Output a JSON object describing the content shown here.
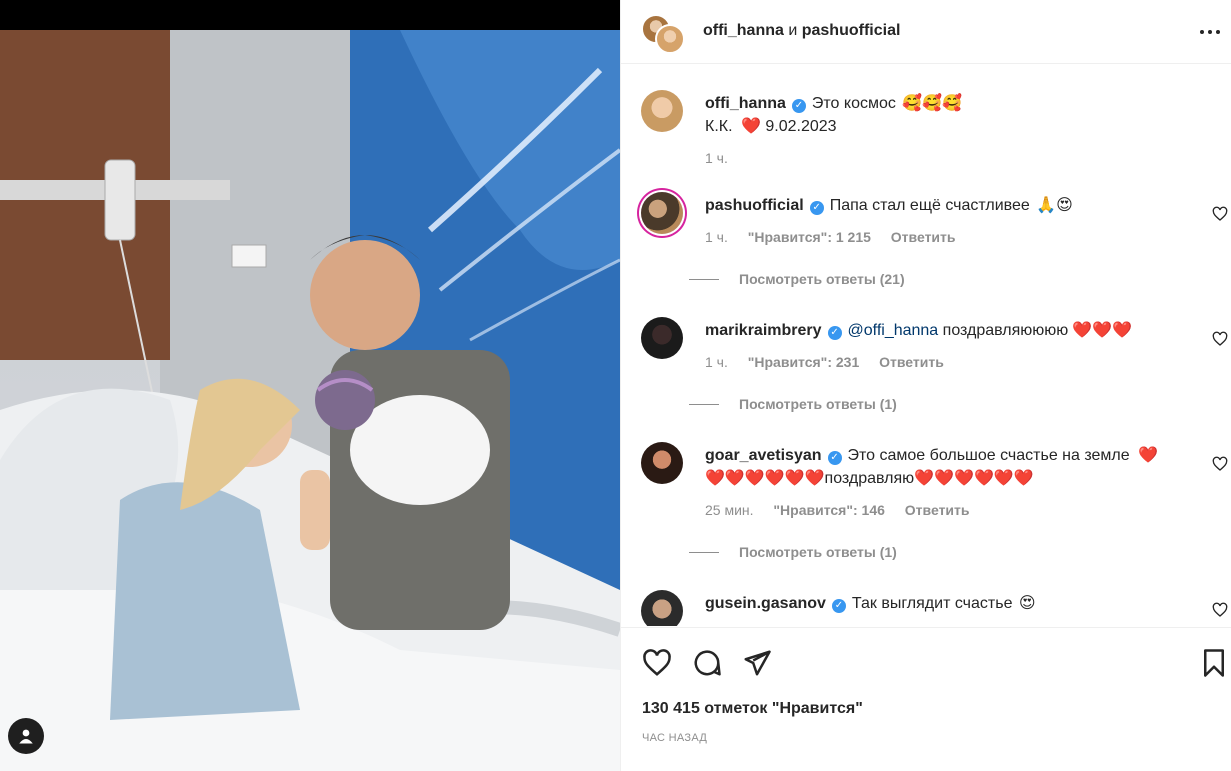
{
  "header": {
    "user1": "offi_hanna",
    "conjunction": "и",
    "user2": "pashuofficial"
  },
  "caption": {
    "username": "offi_hanna",
    "text": "Это космос",
    "emojis": "🥰🥰🥰",
    "line2_prefix": "К.К.",
    "line2_heart": "❤️",
    "line2_date": "9.02.2023",
    "time": "1 ч."
  },
  "comments": [
    {
      "username": "pashuofficial",
      "text": "Папа стал ещё счастливее",
      "emojis": "🙏😍",
      "time": "1 ч.",
      "likes": "\"Нравится\": 1 215",
      "reply": "Ответить",
      "view_replies": "Посмотреть ответы (21)"
    },
    {
      "username": "marikraimbrery",
      "mention": "@offi_hanna",
      "text": "поздравляюююю",
      "emojis": "❤️❤️❤️",
      "time": "1 ч.",
      "likes": "\"Нравится\": 231",
      "reply": "Ответить",
      "view_replies": "Посмотреть ответы (1)"
    },
    {
      "username": "goar_avetisyan",
      "text": "Это самое большое счастье на земле",
      "emojis1": "❤️",
      "emojis2": "❤️❤️❤️❤️❤️❤️",
      "text2": "поздравляю",
      "emojis3": "❤️❤️❤️❤️❤️❤️",
      "time": "25 мин.",
      "likes": "\"Нравится\": 146",
      "reply": "Ответить",
      "view_replies": "Посмотреть ответы (1)"
    },
    {
      "username": "gusein.gasanov",
      "text": "Так выглядит счастье",
      "emojis": "😍"
    }
  ],
  "footer": {
    "likes": "130 415 отметок \"Нравится\"",
    "time_ago": "ЧАС НАЗАД"
  },
  "icons": {
    "like": "heart-icon",
    "comment": "comment-icon",
    "share": "share-icon",
    "save": "bookmark-icon",
    "more": "more-icon",
    "verified": "verified-badge-icon"
  },
  "colors": {
    "verified": "#3897f0",
    "mention": "#00376b",
    "heart": "#e0163b"
  }
}
